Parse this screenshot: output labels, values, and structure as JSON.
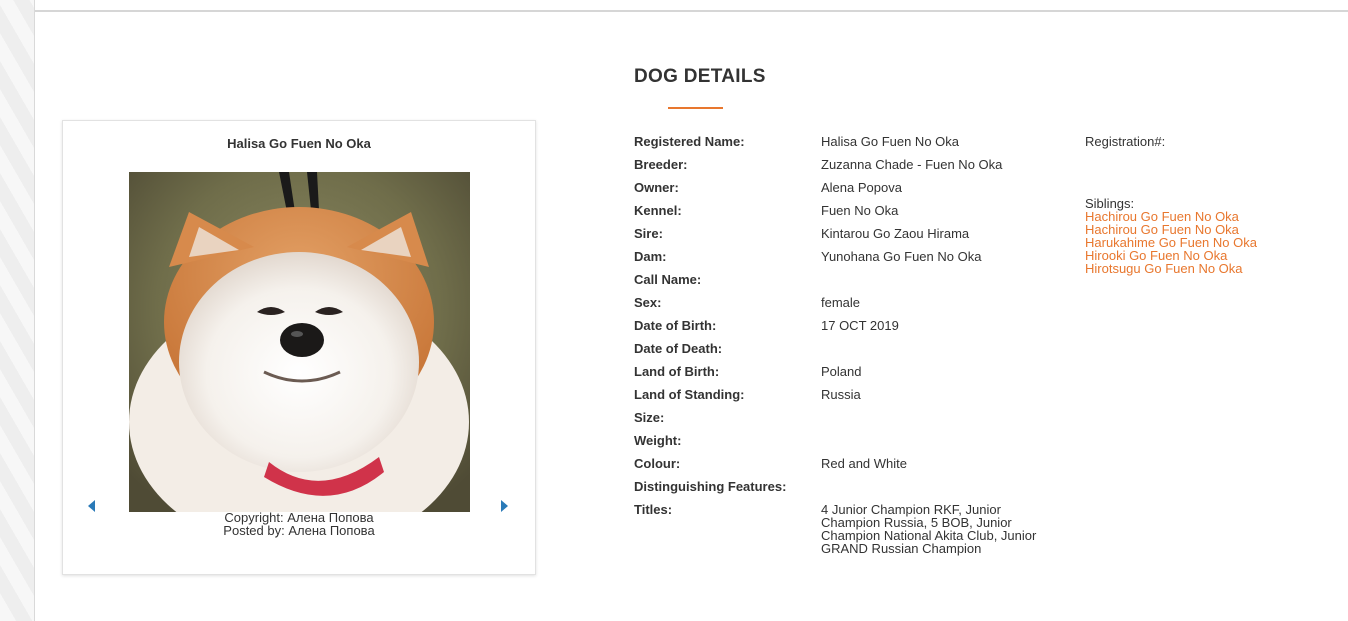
{
  "page": {
    "section_title": "DOG DETAILS"
  },
  "card": {
    "title": "Halisa Go Fuen No Oka",
    "copyright": "Copyright: Алена Попова",
    "posted_by": "Posted by: Алена Попова",
    "prev_icon": "triangle-left-icon",
    "next_icon": "triangle-right-icon"
  },
  "details": [
    {
      "label": "Registered Name:",
      "value": "Halisa Go Fuen No Oka",
      "link": false
    },
    {
      "label": "Breeder:",
      "value": "Zuzanna Chade - Fuen No Oka",
      "link": true
    },
    {
      "label": "Owner:",
      "value": "Alena Popova",
      "link": true
    },
    {
      "label": "Kennel:",
      "value": "Fuen No Oka",
      "link": false
    },
    {
      "label": "Sire:",
      "value": "Kintarou Go Zaou Hirama",
      "link": true
    },
    {
      "label": "Dam:",
      "value": "Yunohana Go Fuen No Oka",
      "link": true
    },
    {
      "label": "Call Name:",
      "value": "",
      "link": false
    },
    {
      "label": "Sex:",
      "value": "female",
      "link": false
    },
    {
      "label": "Date of Birth:",
      "value": "17 OCT 2019",
      "link": false
    },
    {
      "label": "Date of Death:",
      "value": "",
      "link": false
    },
    {
      "label": "Land of Birth:",
      "value": "Poland",
      "link": false
    },
    {
      "label": "Land of Standing:",
      "value": "Russia",
      "link": false
    },
    {
      "label": "Size:",
      "value": "",
      "link": false
    },
    {
      "label": "Weight:",
      "value": "",
      "link": false
    },
    {
      "label": "Colour:",
      "value": "Red and White",
      "link": false
    },
    {
      "label": "Distinguishing Features:",
      "value": "",
      "link": false
    },
    {
      "label": "Titles:",
      "value": "4 Junior Champion RKF, Junior Champion Russia, 5 BOB, Junior Champion National Akita Club, Junior GRAND Russian Champion",
      "link": false
    }
  ],
  "side": {
    "registration_label": "Registration#:",
    "siblings_label": "Siblings:",
    "siblings": [
      "Hachirou Go Fuen No Oka",
      "Hachirou Go Fuen No Oka",
      "Harukahime Go Fuen No Oka",
      "Hirooki Go Fuen No Oka",
      "Hirotsugu Go Fuen No Oka"
    ]
  },
  "colors": {
    "accent": "#e8772e",
    "nav_arrow": "#2a7ab8",
    "text": "#333333"
  }
}
